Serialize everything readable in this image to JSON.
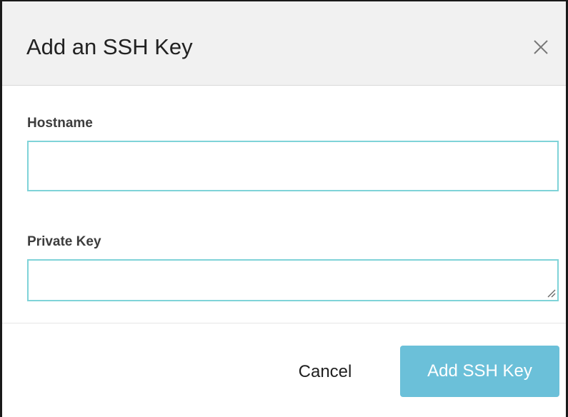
{
  "modal": {
    "title": "Add an SSH Key",
    "close_icon": "close-icon"
  },
  "form": {
    "hostname": {
      "label": "Hostname",
      "value": "",
      "placeholder": ""
    },
    "private_key": {
      "label": "Private Key",
      "value": "",
      "placeholder": ""
    }
  },
  "footer": {
    "cancel_label": "Cancel",
    "submit_label": "Add SSH Key"
  },
  "colors": {
    "header_background": "#f1f1f1",
    "input_border": "#7fd3d8",
    "primary_button": "#6bc0d9",
    "primary_button_text": "#ffffff"
  }
}
